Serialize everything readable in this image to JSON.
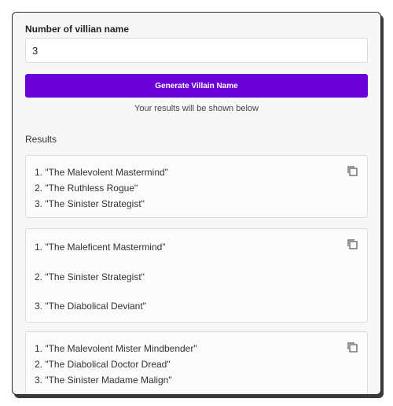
{
  "form": {
    "label": "Number of villian name",
    "value": "3",
    "button_label": "Generate Villain Name",
    "hint": "Your results will be shown below"
  },
  "results": {
    "heading": "Results",
    "cards": [
      {
        "items": [
          "1. \"The Malevolent Mastermind\"",
          "2. \"The Ruthless Rogue\"",
          "3. \"The Sinister Strategist\""
        ]
      },
      {
        "items": [
          "1. \"The Maleficent Mastermind\"",
          "2. \"The Sinister Strategist\"",
          "3. \"The Diabolical Deviant\""
        ]
      },
      {
        "items": [
          "1. \"The Malevolent Mister Mindbender\"",
          "2. \"The Diabolical Doctor Dread\"",
          "3. \"The Sinister Madame Malign\""
        ]
      }
    ]
  },
  "colors": {
    "accent": "#6a00d8"
  },
  "icons": {
    "copy": "copy-icon"
  }
}
